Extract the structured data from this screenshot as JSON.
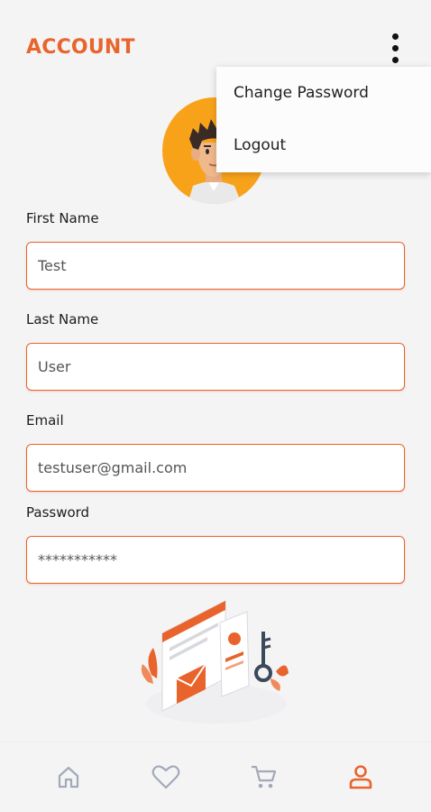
{
  "header": {
    "title": "ACCOUNT"
  },
  "menu": {
    "items": [
      {
        "label": "Change Password"
      },
      {
        "label": "Logout"
      }
    ]
  },
  "form": {
    "first_name": {
      "label": "First Name",
      "value": "Test"
    },
    "last_name": {
      "label": "Last Name",
      "value": "User"
    },
    "email": {
      "label": "Email",
      "value": "testuser@gmail.com"
    },
    "password": {
      "label": "Password",
      "value": "***********"
    }
  },
  "bottom_nav": {
    "items": [
      {
        "icon": "home-icon",
        "active": false
      },
      {
        "icon": "heart-icon",
        "active": false
      },
      {
        "icon": "cart-icon",
        "active": false
      },
      {
        "icon": "user-icon",
        "active": true
      }
    ]
  },
  "colors": {
    "accent": "#e8642c",
    "background": "#f4f4f5",
    "inactive_icon": "#a3a9b8",
    "avatar_bg": "#f8a21a"
  }
}
